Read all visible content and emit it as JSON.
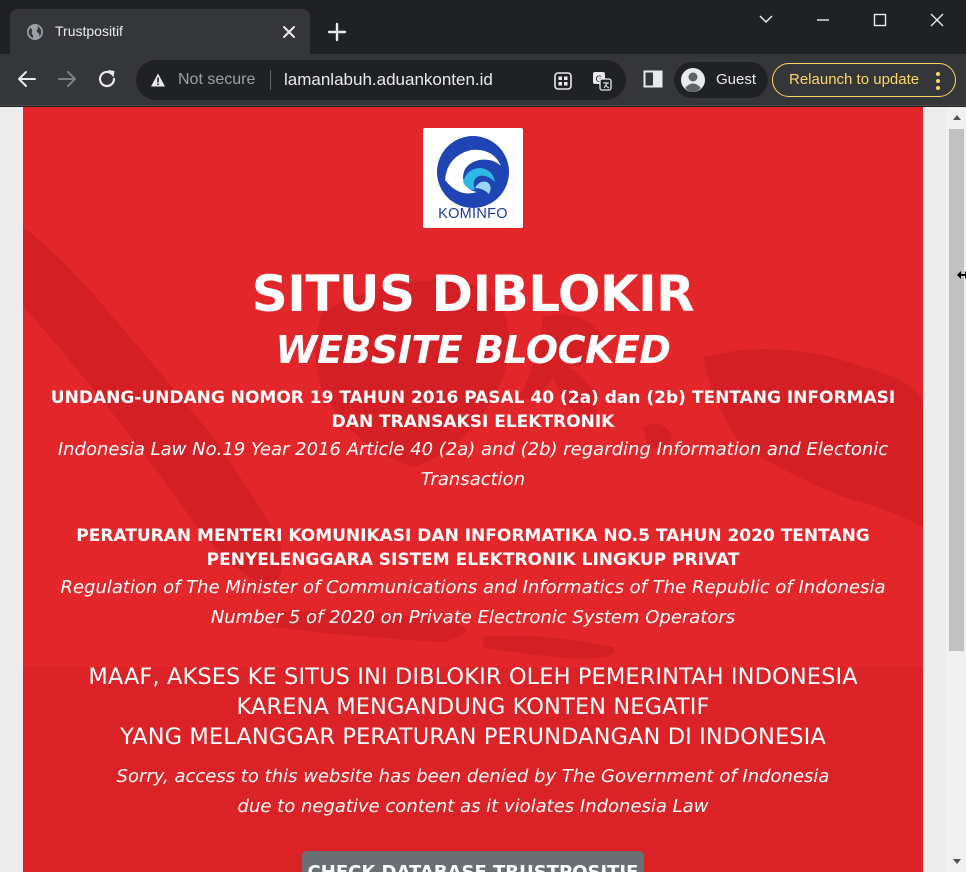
{
  "browser": {
    "tab": {
      "title": "Trustpositif",
      "favicon": "globe-icon"
    },
    "new_tab_icon": "plus-icon",
    "window_controls": [
      "chevron-down-icon",
      "minimize-icon",
      "maximize-icon",
      "close-icon"
    ],
    "nav": {
      "back_icon": "arrow-left-icon",
      "forward_icon": "arrow-right-icon",
      "reload_icon": "reload-icon"
    },
    "omnibox": {
      "security_label": "Not secure",
      "url": "lamanlabuh.aduankonten.id"
    },
    "profile_label": "Guest",
    "update_button_label": "Relaunch to update"
  },
  "page": {
    "logo_text": "KOMINFO",
    "title_id": "SITUS DIBLOKIR",
    "title_en": "WEBSITE BLOCKED",
    "law1_id": "UNDANG-UNDANG NOMOR 19 TAHUN 2016 PASAL 40 (2a) dan (2b) TENTANG INFORMASI DAN TRANSAKSI ELEKTRONIK",
    "law1_en": "Indonesia Law No.19 Year 2016 Article 40 (2a) and (2b) regarding Information and Electonic Transaction",
    "law2_id": "PERATURAN MENTERI KOMUNIKASI DAN INFORMATIKA NO.5 TAHUN 2020 TENTANG PENYELENGGARA SISTEM ELEKTRONIK LINGKUP PRIVAT",
    "law2_en": "Regulation of The Minister of Communications and Informatics of The Republic of Indonesia Number 5 of 2020 on Private Electronic System Operators",
    "notice_id_lines": [
      "MAAF, AKSES KE SITUS INI DIBLOKIR OLEH PEMERINTAH INDONESIA",
      "KARENA MENGANDUNG KONTEN NEGATIF",
      "YANG MELANGGAR PERATURAN PERUNDANGAN DI INDONESIA"
    ],
    "notice_en_lines": [
      "Sorry, access to this website has been denied by The Government of Indonesia",
      "due to negative content as it violates Indonesia Law"
    ],
    "check_button_label": "CHECK DATABASE TRUSTPOSITIF"
  },
  "colors": {
    "browser_dark": "#202124",
    "toolbar": "#35363a",
    "update_accent": "#fdd663",
    "block_red": "#e3262a",
    "button_gray": "#6b6f73"
  }
}
